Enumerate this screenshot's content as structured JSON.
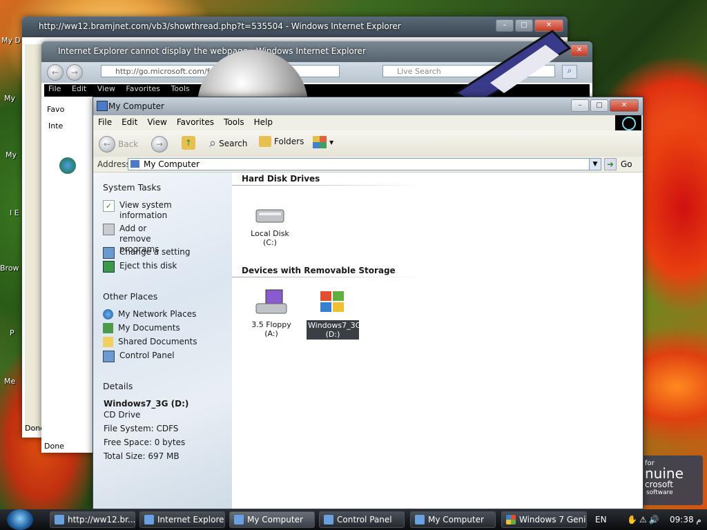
{
  "desktop_icons": [
    "My D",
    "My",
    "My",
    "I E",
    "Brow",
    "P",
    "Me"
  ],
  "ie_back1": {
    "title": "http://ww12.bramjnet.com/vb3/showthread.php?t=535504 - Windows Internet Explorer",
    "status": "Done"
  },
  "ie_back2": {
    "title": "Internet Explorer cannot display the webpage - Windows Internet Explorer",
    "address": "http://go.microsoft.com/fw",
    "search_placeholder": "Live Search",
    "menu": [
      "File",
      "Edit",
      "View",
      "Favorites",
      "Tools",
      "He"
    ],
    "tab_label": "Inte",
    "favorites": "Favo",
    "status": "Done"
  },
  "window": {
    "title": "My Computer"
  },
  "menu": [
    "File",
    "Edit",
    "View",
    "Favorites",
    "Tools",
    "Help"
  ],
  "toolbar": {
    "back": "Back",
    "search": "Search",
    "folders": "Folders"
  },
  "address": {
    "label": "Address",
    "value": "My Computer",
    "go": "Go"
  },
  "system_tasks": {
    "heading": "System Tasks",
    "items": [
      "View system information",
      "Add or remove programs",
      "Change a setting",
      "Eject this disk"
    ]
  },
  "other_places": {
    "heading": "Other Places",
    "items": [
      "My Network Places",
      "My Documents",
      "Shared Documents",
      "Control Panel"
    ]
  },
  "details": {
    "heading": "Details",
    "name": "Windows7_3G (D:)",
    "type": "CD Drive",
    "file_system": "File System: CDFS",
    "free_space": "Free Space: 0 bytes",
    "total_size": "Total Size: 697 MB"
  },
  "groups": {
    "hard_disk": "Hard Disk Drives",
    "removable": "Devices with Removable Storage"
  },
  "drives": {
    "local": "Local Disk (C:)",
    "floppy": "3.5 Floppy (A:)",
    "cd": "Windows7_3G (D:)"
  },
  "taskbar": {
    "buttons": [
      "http://ww12.br...",
      "Internet Explore...",
      "My Computer",
      "Control Panel",
      "My Computer",
      "Windows 7 Genius"
    ],
    "lang": "EN",
    "time": "09:38 م"
  },
  "genuine": {
    "line1": "for",
    "line2": "nuine",
    "line3": "crosoft",
    "line4": "software"
  }
}
